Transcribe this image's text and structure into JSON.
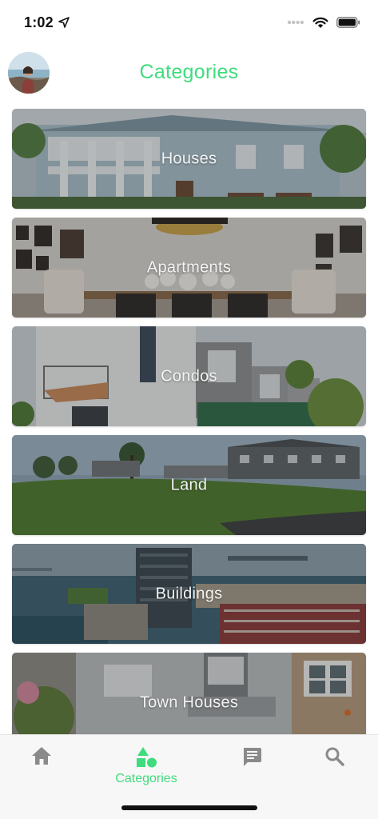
{
  "status_bar": {
    "time": "1:02",
    "icons": [
      "location-arrow-icon",
      "signal-dots-icon",
      "wifi-icon",
      "battery-icon"
    ]
  },
  "header": {
    "title": "Categories",
    "avatar": "profile-avatar"
  },
  "categories": [
    {
      "label": "Houses"
    },
    {
      "label": "Apartments"
    },
    {
      "label": "Condos"
    },
    {
      "label": "Land"
    },
    {
      "label": "Buildings"
    },
    {
      "label": "Town Houses"
    }
  ],
  "tab_bar": {
    "tabs": [
      {
        "icon": "home-icon",
        "label": ""
      },
      {
        "icon": "shapes-icon",
        "label": "Categories",
        "active": true
      },
      {
        "icon": "chat-icon",
        "label": ""
      },
      {
        "icon": "search-icon",
        "label": ""
      }
    ]
  },
  "colors": {
    "accent": "#3fdc7d",
    "tab_inactive": "#8a8a8a",
    "tab_bar_bg": "#f7f7f7"
  }
}
